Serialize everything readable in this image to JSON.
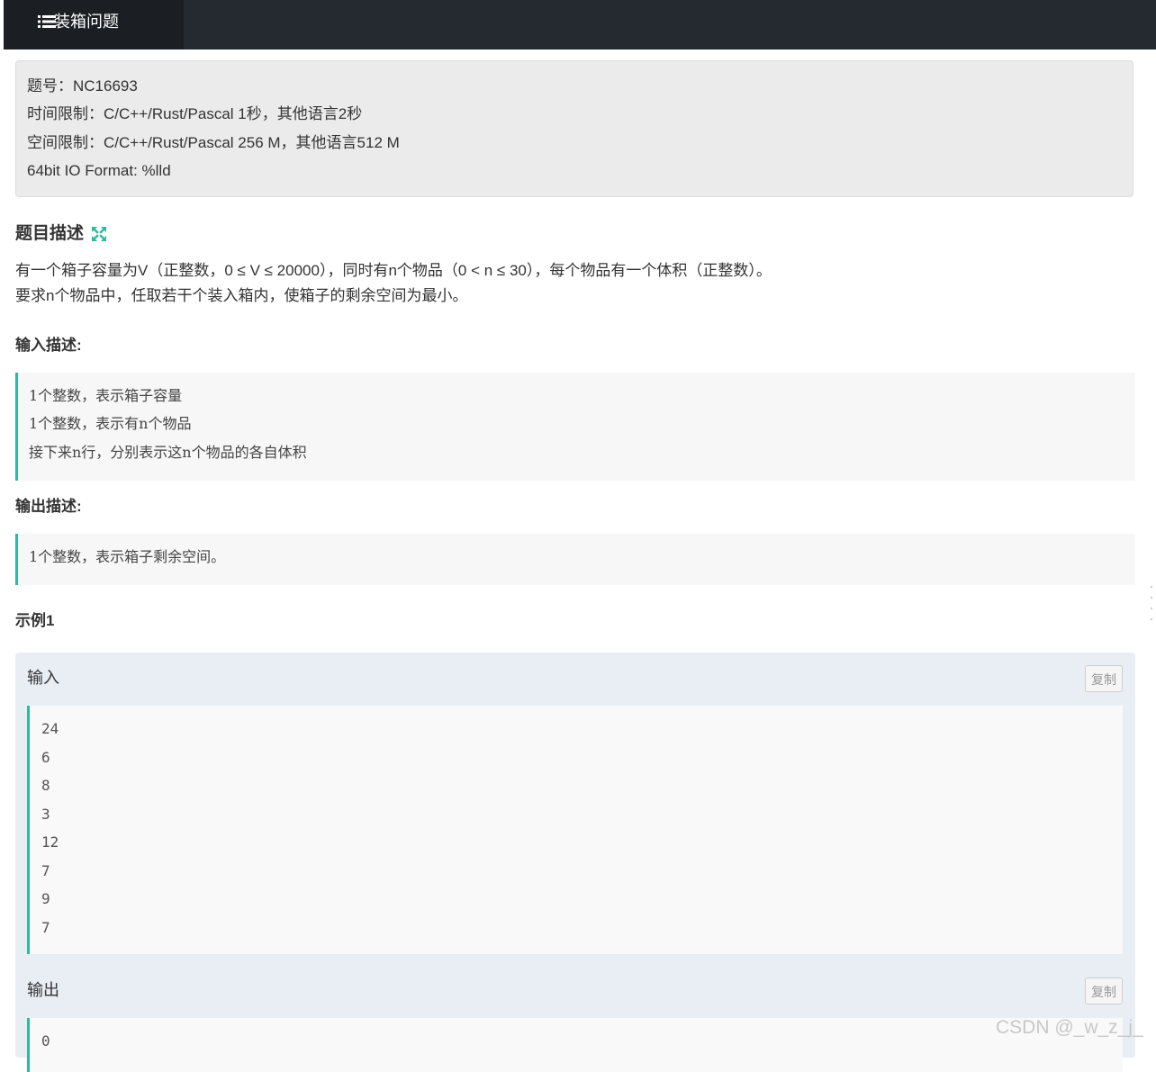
{
  "header": {
    "title": "装箱问题",
    "icon": "list-icon"
  },
  "info": [
    "题号：NC16693",
    "时间限制：C/C++/Rust/Pascal 1秒，其他语言2秒",
    "空间限制：C/C++/Rust/Pascal 256 M，其他语言512 M",
    "64bit IO Format: %lld"
  ],
  "description": {
    "heading": "题目描述",
    "lines": [
      "有一个箱子容量为V（正整数，0 ≤ V ≤ 20000），同时有n个物品（0 < n ≤ 30），每个物品有一个体积（正整数）。",
      "要求n个物品中，任取若干个装入箱内，使箱子的剩余空间为最小。"
    ]
  },
  "input_desc": {
    "heading": "输入描述:",
    "lines": [
      "1个整数，表示箱子容量",
      "1个整数，表示有n个物品",
      "接下来n行，分别表示这n个物品的各自体积"
    ]
  },
  "output_desc": {
    "heading": "输出描述:",
    "lines": [
      "1个整数，表示箱子剩余空间。"
    ]
  },
  "example": {
    "title": "示例1",
    "input_label": "输入",
    "output_label": "输出",
    "copy_label": "复制",
    "input_lines": [
      "24",
      "6",
      "8",
      "3",
      "12",
      "7",
      "9",
      "7"
    ],
    "output_lines": [
      "0"
    ]
  },
  "watermark": "CSDN @_w_z_j_",
  "colors": {
    "accent": "#2dba9b",
    "header_bg": "#252a31",
    "tab_bg": "#1b1f24"
  }
}
